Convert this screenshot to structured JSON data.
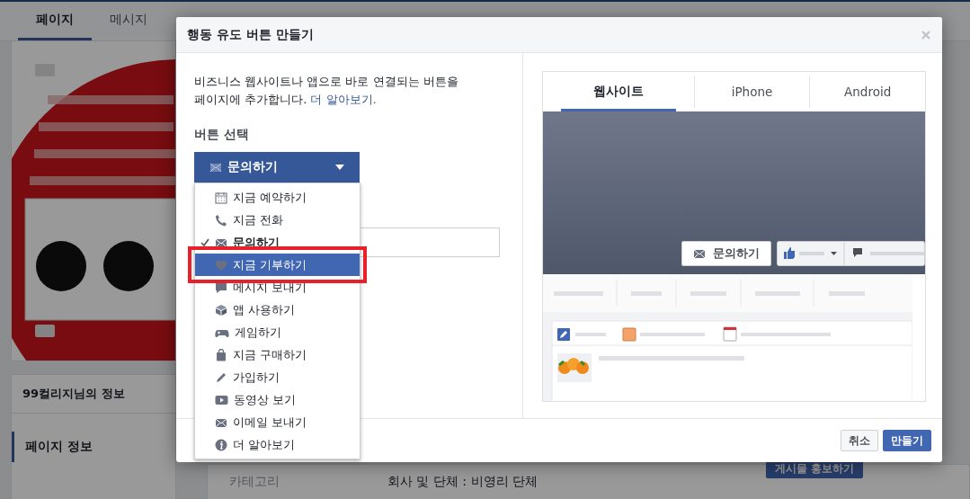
{
  "background_page": {
    "nav_tabs": [
      {
        "label": "페이지",
        "selected": true
      },
      {
        "label": "메시지",
        "selected": false
      }
    ],
    "info_card_title": "99컬리지님의 정보",
    "sidebar_items": [
      {
        "label": "페이지 정보",
        "selected": true
      }
    ],
    "info_rows": [
      {
        "label": "카테고리",
        "value": "회사 및 단체 : 비영리 단체"
      }
    ],
    "promote_button": "게시물 홍보하기"
  },
  "dialog": {
    "title": "행동 유도 버튼 만들기",
    "description": "비즈니스 웹사이트나 앱으로 바로 연결되는 버튼을 페이지에 추가합니다.",
    "learn_more_link": "더 알아보기.",
    "select_label": "버튼 선택",
    "select": {
      "value": "문의하기",
      "expanded": true
    },
    "menu": [
      {
        "label": "지금 예약하기",
        "checked": false,
        "selected": false
      },
      {
        "label": "지금 전화",
        "checked": false,
        "selected": false
      },
      {
        "label": "문의하기",
        "checked": true,
        "selected": false
      },
      {
        "label": "지금 기부하기",
        "checked": false,
        "selected": true
      },
      {
        "label": "메시지 보내기",
        "checked": false,
        "selected": false
      },
      {
        "label": "앱 사용하기",
        "checked": false,
        "selected": false
      },
      {
        "label": "게임하기",
        "checked": false,
        "selected": false
      },
      {
        "label": "지금 구매하기",
        "checked": false,
        "selected": false
      },
      {
        "label": "가입하기",
        "checked": false,
        "selected": false
      },
      {
        "label": "동영상 보기",
        "checked": false,
        "selected": false
      },
      {
        "label": "이메일 보내기",
        "checked": false,
        "selected": false
      },
      {
        "label": "더 알아보기",
        "checked": false,
        "selected": false
      }
    ],
    "preview": {
      "tabs": [
        {
          "label": "웹사이트",
          "selected": true
        },
        {
          "label": "iPhone",
          "selected": false
        },
        {
          "label": "Android",
          "selected": false
        }
      ],
      "cta_button": "문의하기"
    },
    "buttons": [
      {
        "label": "취소",
        "kind": "secondary"
      },
      {
        "label": "만들기",
        "kind": "primary"
      }
    ]
  }
}
